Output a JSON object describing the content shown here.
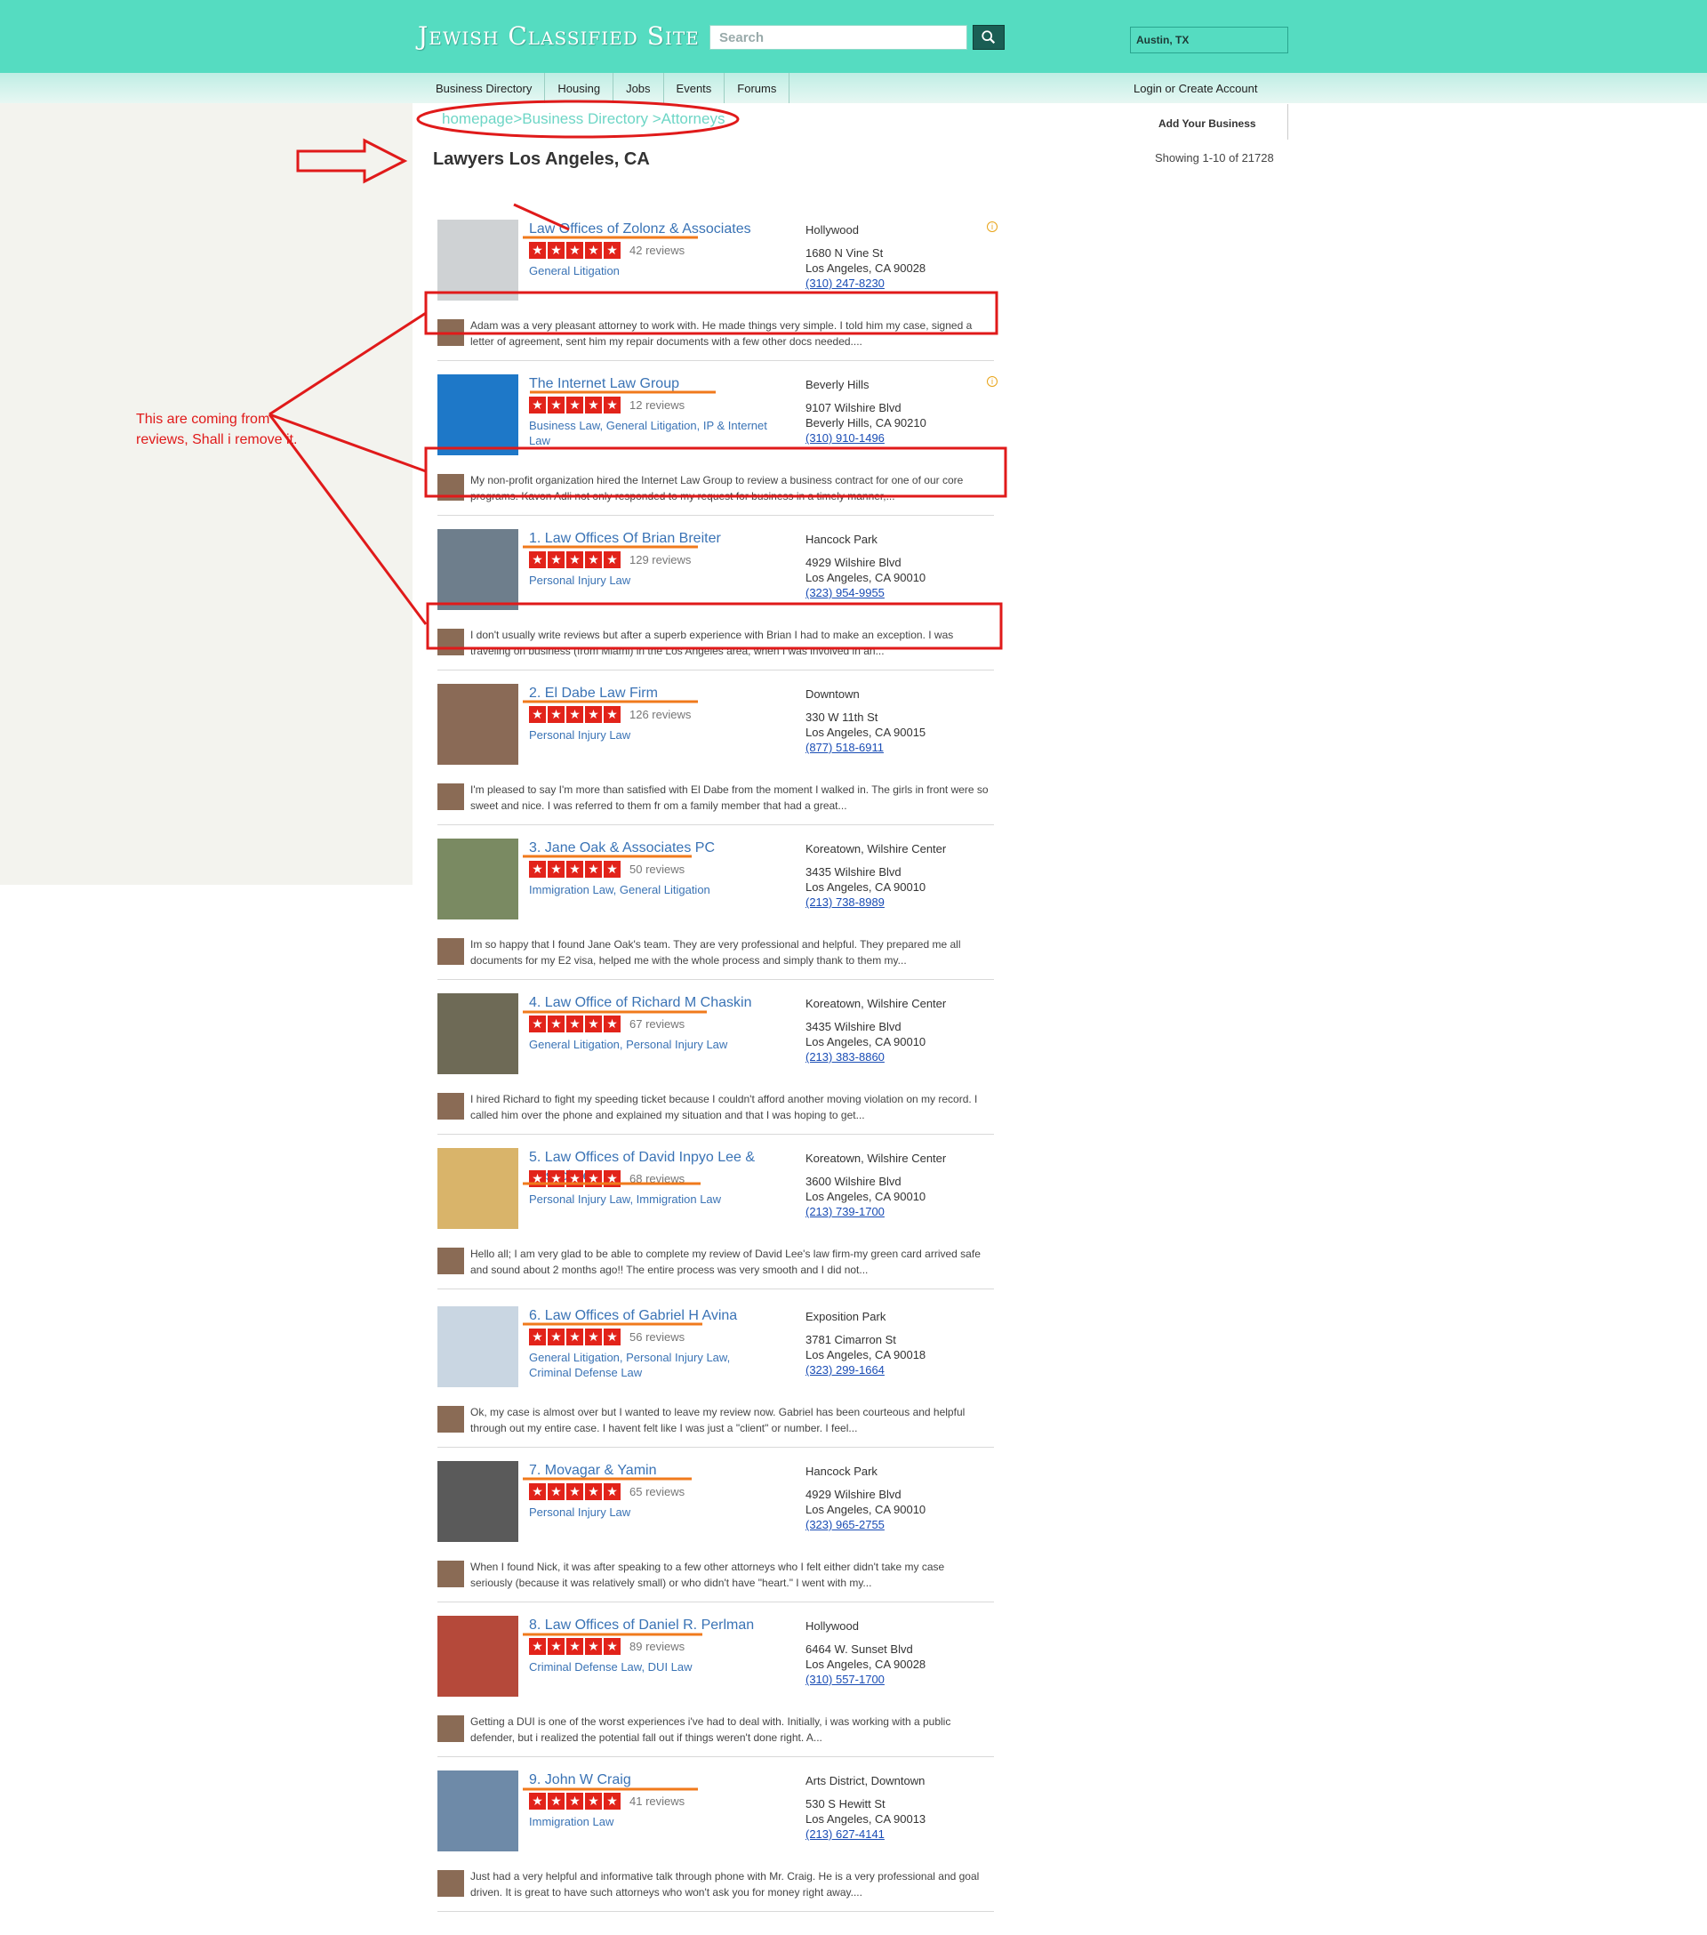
{
  "site": {
    "logo": "Jewish Classified Site",
    "search_placeholder": "Search",
    "location": "Austin, TX"
  },
  "nav": {
    "items": [
      "Business Directory",
      "Housing",
      "Jobs",
      "Events",
      "Forums"
    ],
    "login": "Login or Create Account"
  },
  "page": {
    "breadcrumb": "homepage>Business Directory >Attorneys",
    "title": "Lawyers Los Angeles, CA",
    "add_business": "Add Your Business",
    "showing": "Showing 1-10 of 21728"
  },
  "annotation": {
    "note": "This are coming from reviews, Shall i remove it.",
    "color": "#e01a1a"
  },
  "listings": [
    {
      "name": "Law Offices of Zolonz & Associates",
      "ad": true,
      "reviews": "42 reviews",
      "categories": "General Litigation",
      "neighborhood": "Hollywood",
      "street": "1680 N Vine St",
      "city": "Los Angeles, CA 90028",
      "phone": "(310) 247-8230",
      "snippet": "Adam was a very pleasant attorney to work with.  He made things very simple.  I told him my case, signed a letter of agreement, sent him my repair documents with a few other docs needed...."
    },
    {
      "name": "The Internet Law Group",
      "ad": true,
      "reviews": "12 reviews",
      "categories": "Business Law, General Litigation, IP & Internet Law",
      "neighborhood": "Beverly Hills",
      "street": "9107 Wilshire Blvd",
      "city": "Beverly Hills, CA 90210",
      "phone": "(310) 910-1496",
      "snippet": "My non-profit organization hired the Internet Law Group to review a business contract for one of our core programs. Kavon Adli not only responded to my request for business in a timely manner,..."
    },
    {
      "name": "1. Law Offices Of Brian Breiter",
      "reviews": "129 reviews",
      "categories": "Personal Injury Law",
      "neighborhood": "Hancock Park",
      "street": "4929 Wilshire Blvd",
      "city": "Los Angeles, CA 90010",
      "phone": "(323) 954-9955",
      "snippet": "I don't usually write reviews but after a superb experience with Brian I had to make an exception.  I was traveling on business (from Miami) in the Los Angeles area, when I was involved in an..."
    },
    {
      "name": "2. El Dabe Law Firm",
      "reviews": "126 reviews",
      "categories": "Personal Injury Law",
      "neighborhood": "Downtown",
      "street": "330 W 11th St",
      "city": "Los Angeles, CA 90015",
      "phone": "(877) 518-6911",
      "snippet": "I'm pleased to say I'm more than satisfied with El Dabe from the moment I walked in. The girls in front were so sweet and nice. I was referred to them fr om a family member that had a great..."
    },
    {
      "name": "3. Jane Oak & Associates PC",
      "reviews": "50 reviews",
      "categories": "Immigration Law, General Litigation",
      "neighborhood": "Koreatown, Wilshire Center",
      "street": "3435 Wilshire Blvd",
      "city": "Los Angeles, CA 90010",
      "phone": "(213) 738-8989",
      "snippet": "Im so happy that I found Jane Oak's team. They are very professional and helpful. They prepared me all documents for my E2 visa, helped me with the whole process and simply thank to them my..."
    },
    {
      "name": "4. Law Office of Richard M Chaskin",
      "reviews": "67 reviews",
      "categories": "General Litigation, Personal Injury Law",
      "neighborhood": "Koreatown, Wilshire Center",
      "street": "3435 Wilshire Blvd",
      "city": "Los Angeles, CA 90010",
      "phone": "(213) 383-8860",
      "snippet": "I hired Richard to fight my speeding ticket because I couldn't afford another moving violation on my record. I called him over the phone and explained my situation and that I was hoping to get..."
    },
    {
      "name": "5. Law Offices of David Inpyo Lee & Associates",
      "reviews": "68 reviews",
      "categories": "Personal Injury Law, Immigration Law",
      "neighborhood": "Koreatown, Wilshire Center",
      "street": "3600 Wilshire Blvd",
      "city": "Los Angeles, CA 90010",
      "phone": "(213) 739-1700",
      "snippet": "Hello all;  I am very glad to be able to complete my review of David Lee's law firm-my green card arrived safe and sound about 2 months ago!!   The entire process was very smooth and I did not..."
    },
    {
      "name": "6. Law Offices of Gabriel H Avina",
      "reviews": "56 reviews",
      "categories": "General Litigation, Personal Injury Law, Criminal Defense Law",
      "neighborhood": "Exposition Park",
      "street": "3781 Cimarron St",
      "city": "Los Angeles, CA 90018",
      "phone": "(323) 299-1664",
      "snippet": "Ok, my case is almost over but I wanted to leave my review now. Gabriel has been courteous and helpful through out my entire case. I havent felt like I was just a \"client\" or number. I feel..."
    },
    {
      "name": "7. Movagar & Yamin",
      "reviews": "65 reviews",
      "categories": "Personal Injury Law",
      "neighborhood": "Hancock Park",
      "street": "4929 Wilshire Blvd",
      "city": "Los Angeles, CA 90010",
      "phone": "(323) 965-2755",
      "snippet": "When I found Nick, it was after speaking to a few other attorneys who I felt either didn't take my case seriously (because it was relatively small) or who didn't have \"heart.\" I went with my..."
    },
    {
      "name": "8. Law Offices of Daniel R. Perlman",
      "reviews": "89 reviews",
      "categories": "Criminal Defense Law, DUI Law",
      "neighborhood": "Hollywood",
      "street": "6464 W. Sunset Blvd",
      "city": "Los Angeles, CA 90028",
      "phone": "(310) 557-1700",
      "snippet": "Getting a DUI is one of the worst experiences i've had to deal with.  Initially, i was working with a public defender, but i realized the potential fall out if things weren't done right.  A..."
    },
    {
      "name": "9. John W Craig",
      "reviews": "41 reviews",
      "categories": "Immigration Law",
      "neighborhood": "Arts District, Downtown",
      "street": "530 S Hewitt St",
      "city": "Los Angeles, CA 90013",
      "phone": "(213) 627-4141",
      "snippet": "Just had a very helpful and informative talk through phone with Mr. Craig. He is a very professional and goal driven. It is great to have such attorneys who won't ask you for money right away...."
    }
  ]
}
